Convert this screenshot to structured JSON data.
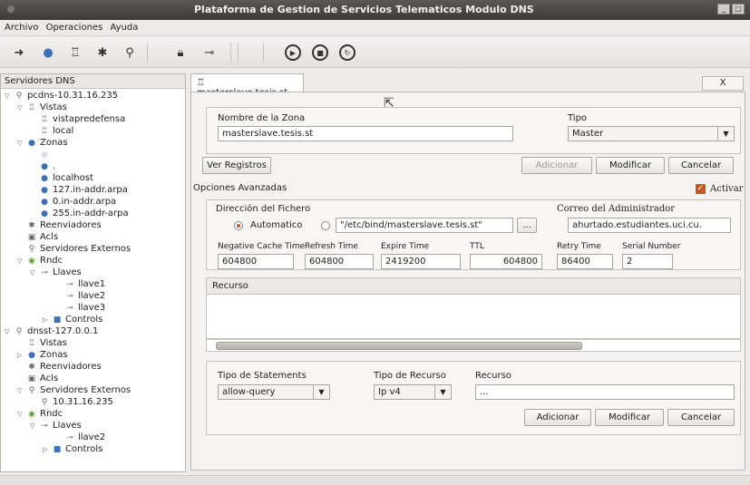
{
  "window": {
    "title": "Plataforma de Gestion de Servicios Telematicos Modulo DNS"
  },
  "menu": [
    "Archivo",
    "Operaciones",
    "Ayuda"
  ],
  "sidebar": {
    "title": "Servidores DNS",
    "tree": [
      "pcdns-10.31.16.235",
      "Vistas",
      "vistapredefensa",
      "local",
      "Zonas",
      "masterslave.tesis.st",
      ".",
      "localhost",
      "127.in-addr.arpa",
      "0.in-addr.arpa",
      "255.in-addr-arpa",
      "Reenviadores",
      "Acls",
      "Servidores Externos",
      "Rndc",
      "Llaves",
      "llave1",
      "llave2",
      "llave3",
      "Controls",
      "dnsst-127.0.0.1",
      "Vistas",
      "Zonas",
      "Reenviadores",
      "Acls",
      "Servidores Externos",
      "10.31.16.235",
      "Rndc",
      "Llaves",
      "llave2",
      "Controls"
    ]
  },
  "tab": {
    "label": "masterslave.tesis.st",
    "close_label": "X"
  },
  "zone": {
    "name_label": "Nombre de la Zona",
    "name_value": "masterslave.tesis.st",
    "type_label": "Tipo",
    "type_value": "Master"
  },
  "actions": {
    "ver_registros": "Ver Registros",
    "adicionar": "Adicionar",
    "modificar": "Modificar",
    "cancelar": "Cancelar"
  },
  "advanced": {
    "title": "Opciones Avanzadas",
    "activar_label": "Activar",
    "activar_checked": true,
    "dir_label": "Dirección del Fichero",
    "automatico_label": "Automatico",
    "file_path": "\"/etc/bind/masterslave.tesis.st\"",
    "browse_label": "...",
    "admin_label": "Correo del Administrador",
    "admin_value": "ahurtado.estudiantes.uci.cu.",
    "fields": {
      "negative_cache_label": "Negative Cache Time",
      "negative_cache_value": "604800",
      "refresh_label": "Refresh Time",
      "refresh_value": "604800",
      "expire_label": "Expire Time",
      "expire_value": "2419200",
      "ttl_label": "TTL",
      "ttl_value": "604800",
      "retry_label": "Retry Time",
      "retry_value": "86400",
      "serial_label": "Serial Number",
      "serial_value": "2"
    }
  },
  "recurso_table": {
    "header": "Recurso"
  },
  "statements": {
    "tipo_statements_label": "Tipo de Statements",
    "tipo_statements_value": "allow-query",
    "tipo_recurso_label": "Tipo de Recurso",
    "tipo_recurso_value": "Ip v4",
    "recurso_label": "Recurso",
    "recurso_value": "...",
    "adicionar": "Adicionar",
    "modificar": "Modificar",
    "cancelar": "Cancelar"
  },
  "colors": {
    "accent": "#c35a1f",
    "titlebar": "#3d3b38",
    "selection": "#8f8c86"
  }
}
